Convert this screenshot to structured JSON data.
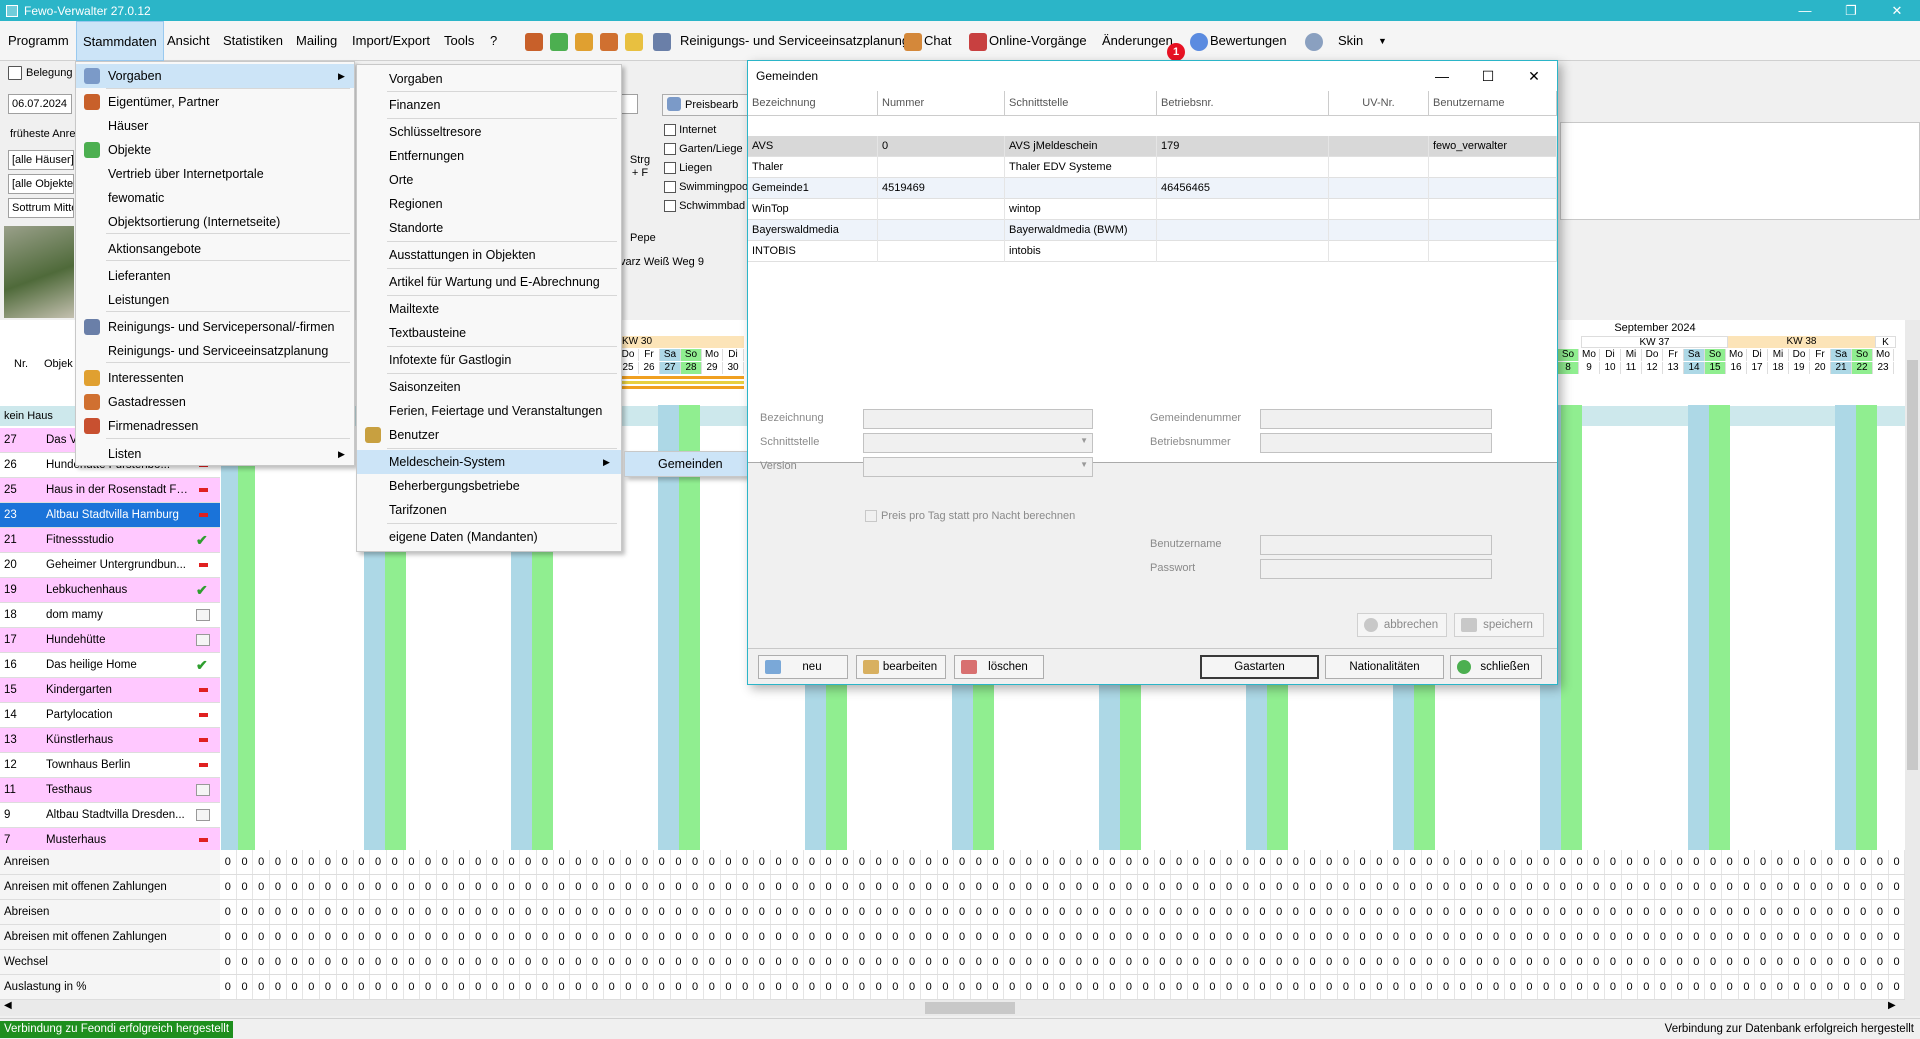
{
  "window": {
    "title": "Fewo-Verwalter 27.0.12",
    "minimize": "—",
    "maximize": "❐",
    "close": "✕"
  },
  "menubar": {
    "items": [
      "Programm",
      "Stammdaten",
      "Ansicht",
      "Statistiken",
      "Mailing",
      "Import/Export",
      "Tools",
      "?"
    ],
    "toolbar_labels": {
      "reinigung": "Reinigungs- und Serviceeinsatzplanung",
      "chat": "Chat",
      "online": "Online-Vorgänge",
      "aenderungen": "Änderungen",
      "bewertungen": "Bewertungen",
      "skin": "Skin"
    },
    "badge": "1"
  },
  "left": {
    "belegung": "Belegung",
    "date": "06.07.2024",
    "frueheste": "früheste Anre",
    "haeuser": "[alle Häuser]",
    "objekte": "[alle Objekte]",
    "ort": "Sottrum Mitte",
    "preisbearb": "Preisbearb",
    "checkboxes": [
      "Internet",
      "Garten/Liege",
      "Liegen",
      "Swimmingpoo",
      "Schwimmbad"
    ],
    "strg": "Strg + F",
    "pepe": "Pepe",
    "strasse": "varz Weiß Weg 9"
  },
  "grid": {
    "hdr_nr": "Nr.",
    "hdr_obj": "Objek",
    "kw30": "KW 30",
    "kw37": "KW 37",
    "kw38": "KW 38",
    "kwk": "K",
    "month_sep": "September 2024",
    "days_left": [
      "Do",
      "Fr",
      "Sa",
      "So",
      "Mo",
      "Di"
    ],
    "dates_left": [
      "25",
      "26",
      "27",
      "28",
      "29",
      "30"
    ],
    "days_right": [
      "So",
      "Mo",
      "Di",
      "Mi",
      "Do",
      "Fr",
      "Sa",
      "So",
      "Mo",
      "Di",
      "Mi",
      "Do",
      "Fr",
      "Sa",
      "So",
      "Mo"
    ],
    "dates_right": [
      "8",
      "9",
      "10",
      "11",
      "12",
      "13",
      "14",
      "15",
      "16",
      "17",
      "18",
      "19",
      "20",
      "21",
      "22",
      "23"
    ],
    "group": "kein Haus",
    "rows": [
      {
        "nr": "27",
        "name": "Das V",
        "pink": true,
        "st": "ok"
      },
      {
        "nr": "26",
        "name": "Hundehütte Fürstenbo...",
        "pink": false,
        "st": "no"
      },
      {
        "nr": "25",
        "name": "Haus in der Rosenstadt Fo...",
        "pink": true,
        "st": "no"
      },
      {
        "nr": "23",
        "name": "Altbau Stadtvilla Hamburg",
        "pink": false,
        "st": "no",
        "sel": true
      },
      {
        "nr": "21",
        "name": "Fitnessstudio",
        "pink": true,
        "st": "ok"
      },
      {
        "nr": "20",
        "name": "Geheimer Untergrundbun...",
        "pink": false,
        "st": "no"
      },
      {
        "nr": "19",
        "name": "Lebkuchenhaus",
        "pink": true,
        "st": "ok"
      },
      {
        "nr": "18",
        "name": "dom mamy",
        "pink": false,
        "st": "cal"
      },
      {
        "nr": "17",
        "name": "Hundehütte",
        "pink": true,
        "st": "cal"
      },
      {
        "nr": "16",
        "name": "Das heilige Home",
        "pink": false,
        "st": "ok"
      },
      {
        "nr": "15",
        "name": "Kindergarten",
        "pink": true,
        "st": "no"
      },
      {
        "nr": "14",
        "name": "Partylocation",
        "pink": false,
        "st": "no"
      },
      {
        "nr": "13",
        "name": "Künstlerhaus",
        "pink": true,
        "st": "no"
      },
      {
        "nr": "12",
        "name": "Townhaus Berlin",
        "pink": false,
        "st": "no"
      },
      {
        "nr": "11",
        "name": "Testhaus",
        "pink": true,
        "st": "cal"
      },
      {
        "nr": "9",
        "name": "Altbau Stadtvilla Dresden...",
        "pink": false,
        "st": "cal"
      },
      {
        "nr": "7",
        "name": "Musterhaus",
        "pink": true,
        "st": "no"
      }
    ],
    "stats": [
      "Anreisen",
      "Anreisen mit offenen Zahlungen",
      "Abreisen",
      "Abreisen mit offenen Zahlungen",
      "Wechsel",
      "Auslastung in %"
    ],
    "zero": "0"
  },
  "menu_stammdaten": [
    "Vorgaben",
    "Eigentümer, Partner",
    "Häuser",
    "Objekte",
    "Vertrieb über Internetportale",
    "fewomatic",
    "Objektsortierung (Internetseite)",
    "Aktionsangebote",
    "Lieferanten",
    "Leistungen",
    "Reinigungs- und Servicepersonal/-firmen",
    "Reinigungs- und Serviceeinsatzplanung",
    "Interessenten",
    "Gastadressen",
    "Firmenadressen",
    "Listen"
  ],
  "menu_vorgaben": [
    "Vorgaben",
    "Finanzen",
    "Schlüsseltresore",
    "Entfernungen",
    "Orte",
    "Regionen",
    "Standorte",
    "Ausstattungen in Objekten",
    "Artikel für Wartung und E-Abrechnung",
    "Mailtexte",
    "Textbausteine",
    "Infotexte für Gastlogin",
    "Saisonzeiten",
    "Ferien, Feiertage und Veranstaltungen",
    "Benutzer",
    "Meldeschein-System",
    "Beherbergungsbetriebe",
    "Tarifzonen",
    "eigene Daten (Mandanten)"
  ],
  "menu_meldeschein": [
    "Gemeinden"
  ],
  "dialog": {
    "title": "Gemeinden",
    "columns": [
      "Bezeichnung",
      "Nummer",
      "Schnittstelle",
      "Betriebsnr.",
      "UV-Nr.",
      "Benutzername"
    ],
    "rows": [
      [
        "AVS",
        "0",
        "AVS jMeldeschein",
        "179",
        "",
        "fewo_verwalter"
      ],
      [
        "Thaler",
        "",
        "Thaler EDV Systeme",
        "",
        "",
        ""
      ],
      [
        "Gemeinde1",
        "4519469",
        "",
        "46456465",
        "",
        ""
      ],
      [
        "WinTop",
        "",
        "wintop",
        "",
        "",
        ""
      ],
      [
        "Bayerswaldmedia",
        "",
        "Bayerwaldmedia (BWM)",
        "",
        "",
        ""
      ],
      [
        "INTOBIS",
        "",
        "intobis",
        "",
        "",
        ""
      ]
    ],
    "labels": {
      "bezeichnung": "Bezeichnung",
      "schnittstelle": "Schnittstelle",
      "version": "Version",
      "gemeindenummer": "Gemeindenummer",
      "betriebsnummer": "Betriebsnummer",
      "preis": "Preis pro Tag statt pro Nacht berechnen",
      "benutzername": "Benutzername",
      "passwort": "Passwort"
    },
    "buttons": {
      "abbrechen": "abbrechen",
      "speichern": "speichern",
      "neu": "neu",
      "bearbeiten": "bearbeiten",
      "loeschen": "löschen",
      "gastarten": "Gastarten",
      "nationalitaeten": "Nationalitäten",
      "schliessen": "schließen"
    }
  },
  "statusbar": {
    "left": "Verbindung zu Feondi erfolgreich hergestellt",
    "right": "Verbindung zur Datenbank erfolgreich hergestellt"
  },
  "colors": {
    "accent": "#2bb5c8",
    "pink": "#ffc8ff",
    "selected": "#1a73d9",
    "green": "#90ee90",
    "blue": "#add8e6"
  }
}
